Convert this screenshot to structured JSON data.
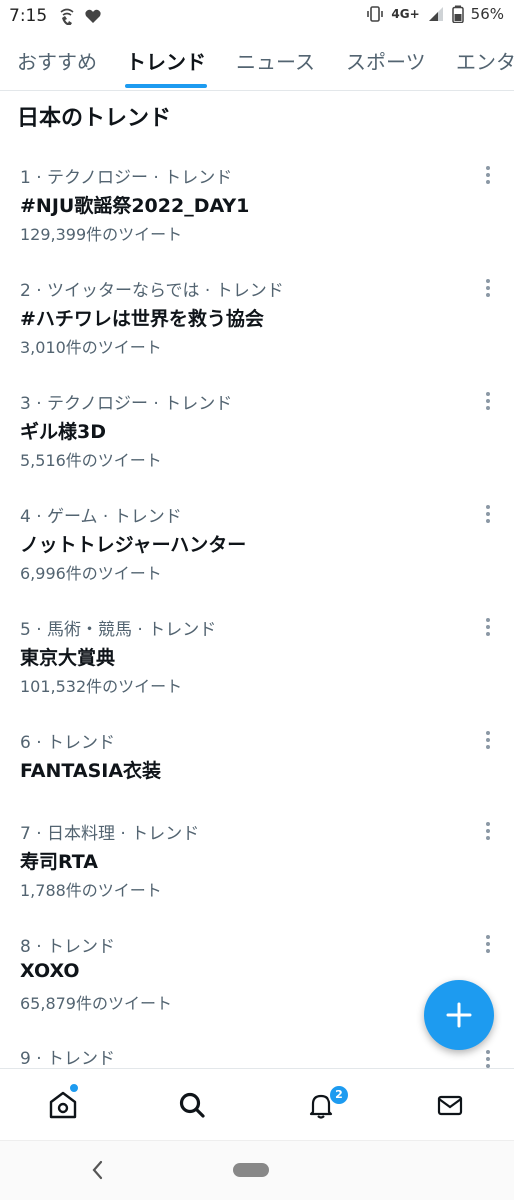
{
  "status_bar": {
    "time": "7:15",
    "network": "4G+",
    "battery": "56%"
  },
  "tabs": [
    {
      "label": "おすすめ",
      "active": false
    },
    {
      "label": "トレンド",
      "active": true
    },
    {
      "label": "ニュース",
      "active": false
    },
    {
      "label": "スポーツ",
      "active": false
    },
    {
      "label": "エンタ",
      "active": false
    }
  ],
  "section_title": "日本のトレンド",
  "trends": [
    {
      "meta": "1 · テクノロジー · トレンド",
      "name": "#NJU歌謡祭2022_DAY1",
      "count": "129,399件のツイート"
    },
    {
      "meta": "2 · ツイッターならでは · トレンド",
      "name": "#ハチワレは世界を救う協会",
      "count": "3,010件のツイート"
    },
    {
      "meta": "3 · テクノロジー · トレンド",
      "name": "ギル様3D",
      "count": "5,516件のツイート"
    },
    {
      "meta": "4 · ゲーム · トレンド",
      "name": "ノットトレジャーハンター",
      "count": "6,996件のツイート"
    },
    {
      "meta": "5 · 馬術・競馬 · トレンド",
      "name": "東京大賞典",
      "count": "101,532件のツイート"
    },
    {
      "meta": "6 · トレンド",
      "name": "FANTASIA衣装",
      "count": ""
    },
    {
      "meta": "7 · 日本料理 · トレンド",
      "name": "寿司RTA",
      "count": "1,788件のツイート"
    },
    {
      "meta": "8 · トレンド",
      "name": "XOXO",
      "count": "65,879件のツイート"
    },
    {
      "meta": "9 · トレンド",
      "name": "",
      "count": ""
    }
  ],
  "bottom_nav": {
    "notifications_badge": "2"
  },
  "colors": {
    "accent": "#1d9bf0",
    "text_primary": "#0f1419",
    "text_secondary": "#536471"
  },
  "icons": {
    "fab": "plus-icon",
    "nav": [
      "home-icon",
      "search-icon",
      "bell-icon",
      "mail-icon"
    ],
    "system_nav": [
      "back-chevron-icon",
      "home-pill-icon"
    ]
  }
}
